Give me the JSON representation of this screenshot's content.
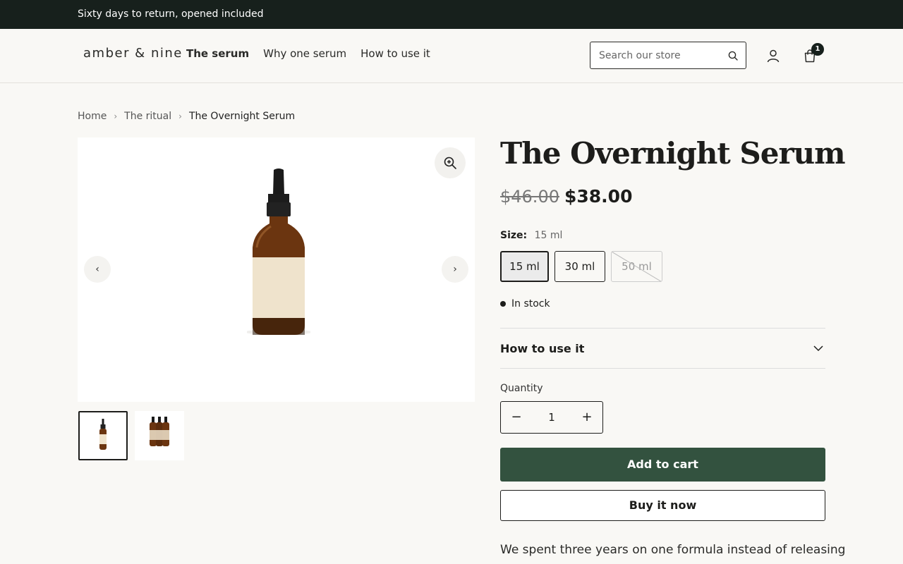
{
  "announcement": {
    "text": "Sixty days to return, opened included"
  },
  "header": {
    "logo": "amber & nine",
    "nav": [
      {
        "label": "The serum",
        "active": true
      },
      {
        "label": "Why one serum",
        "active": false
      },
      {
        "label": "How to use it",
        "active": false
      }
    ],
    "search": {
      "placeholder": "Search our store",
      "value": ""
    },
    "cart_count": "1"
  },
  "breadcrumb": {
    "items": [
      "Home",
      "The ritual"
    ],
    "current": "The Overnight Serum"
  },
  "gallery": {
    "prev": "‹",
    "next": "›",
    "thumbnails": 2,
    "selected_thumbnail": 1
  },
  "product": {
    "title": "The Overnight Serum",
    "price_old": "$46.00",
    "price_new": "$38.00",
    "size_label": "Size:",
    "size_value": "15 ml",
    "sizes": [
      {
        "label": "15 ml",
        "selected": true,
        "available": true
      },
      {
        "label": "30 ml",
        "selected": false,
        "available": true
      },
      {
        "label": "50 ml",
        "selected": false,
        "available": false
      }
    ],
    "stock": "In stock",
    "accordion_label": "How to use it",
    "quantity_label": "Quantity",
    "quantity": "1",
    "add_to_cart": "Add to cart",
    "buy_now": "Buy it now",
    "description": "We spent three years on one formula instead of releasing"
  },
  "colors": {
    "announce_bg": "#17201c",
    "accent": "#33523f",
    "page_bg": "#f9f8f5"
  }
}
